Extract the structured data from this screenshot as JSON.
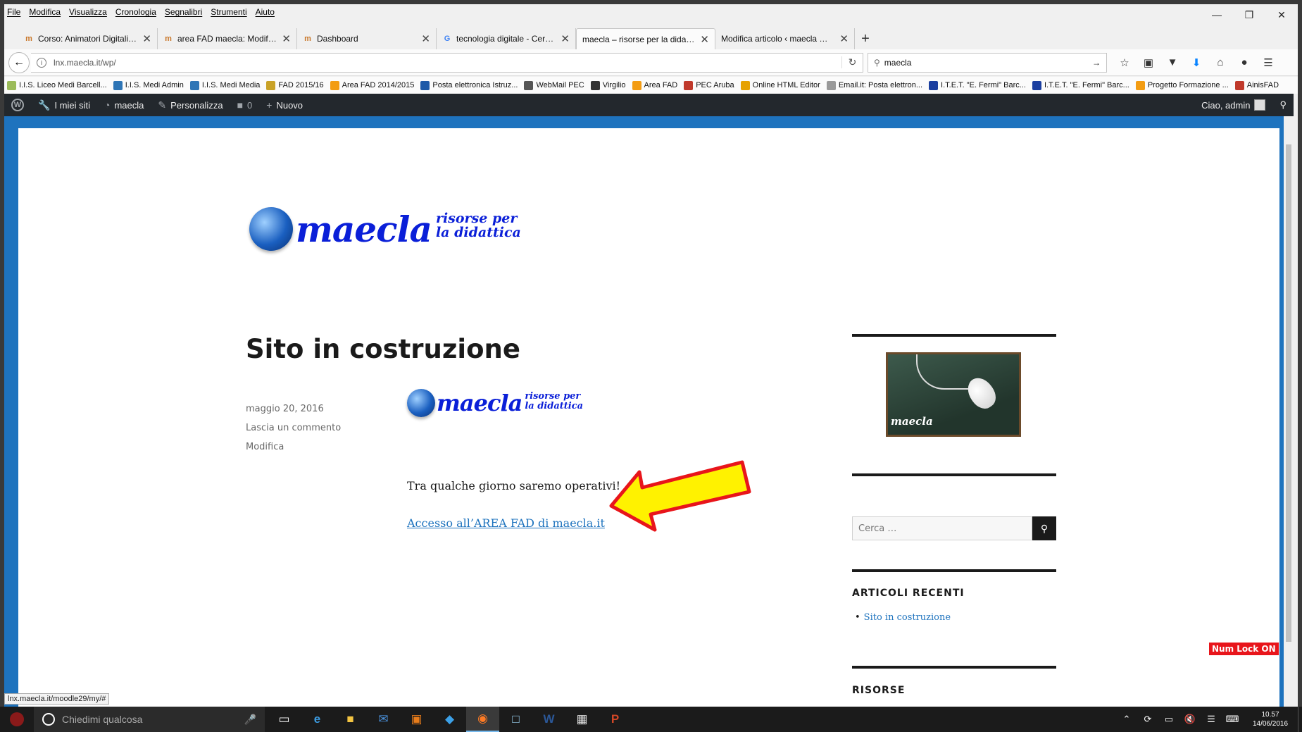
{
  "browser": {
    "menu": [
      "File",
      "Modifica",
      "Visualizza",
      "Cronologia",
      "Segnalibri",
      "Strumenti",
      "Aiuto"
    ],
    "tabs": [
      {
        "label": "Corso: Animatori Digitali -...",
        "icon": "moodle-icon"
      },
      {
        "label": "area FAD maecla: Modifica",
        "icon": "moodle-icon"
      },
      {
        "label": "Dashboard",
        "icon": "moodle-icon"
      },
      {
        "label": "tecnologia digitale - Cerca...",
        "icon": "google-icon"
      },
      {
        "label": "maecla – risorse per la didattica",
        "icon": "none",
        "active": true
      },
      {
        "label": "Modifica articolo ‹ maecla — ...",
        "icon": "none"
      }
    ],
    "url": "lnx.maecla.it/wp/",
    "search_value": "maecla",
    "bookmarks": [
      {
        "label": "I.I.S. Liceo Medi Barcell...",
        "color": "#9bbb59"
      },
      {
        "label": "I.I.S. Medi Admin",
        "color": "#2e75b6"
      },
      {
        "label": "I.I.S. Medi Media",
        "color": "#2e75b6"
      },
      {
        "label": "FAD 2015/16",
        "color": "#c9a227"
      },
      {
        "label": "Area FAD 2014/2015",
        "color": "#f39c12"
      },
      {
        "label": "Posta elettronica Istruz...",
        "color": "#1e5aa8"
      },
      {
        "label": "WebMail PEC",
        "color": "#555555"
      },
      {
        "label": "Virgilio",
        "color": "#333333"
      },
      {
        "label": "Area FAD",
        "color": "#f39c12"
      },
      {
        "label": "PEC Aruba",
        "color": "#c0392b"
      },
      {
        "label": "Online HTML Editor",
        "color": "#e6a100"
      },
      {
        "label": "Email.it: Posta elettron...",
        "color": "#999999"
      },
      {
        "label": "I.T.E.T. \"E. Fermi\" Barc...",
        "color": "#1b3fa0"
      },
      {
        "label": "I.T.E.T. \"E. Fermi\" Barc...",
        "color": "#1b3fa0"
      },
      {
        "label": "Progetto Formazione ...",
        "color": "#f39c12"
      },
      {
        "label": "AinisFAD",
        "color": "#c0392b"
      }
    ],
    "status_url": "lnx.maecla.it/moodle29/my/#"
  },
  "adminbar": {
    "items": [
      "I miei siti",
      "maecla",
      "Personalizza",
      "0",
      "Nuovo"
    ],
    "greeting": "Ciao, admin"
  },
  "site": {
    "brand": "maecla",
    "tagline_1": "risorse per",
    "tagline_2": "la didattica"
  },
  "post": {
    "title": "Sito in costruzione",
    "date": "maggio 20, 2016",
    "comment_link": "Lascia un commento",
    "edit_link": "Modifica",
    "body_text": "Tra qualche giorno saremo operativi!",
    "link_text": "Accesso all’AREA FAD di maecla.it"
  },
  "sidebar": {
    "image_brand": "maecla",
    "search_placeholder": "Cerca …",
    "recent_title": "ARTICOLI RECENTI",
    "recent_posts": [
      "Sito in costruzione"
    ],
    "resources_title": "RISORSE"
  },
  "overlay": {
    "numlock": "Num Lock ON"
  },
  "taskbar": {
    "search_placeholder": "Chiedimi qualcosa",
    "time": "10.57",
    "date": "14/06/2016"
  }
}
